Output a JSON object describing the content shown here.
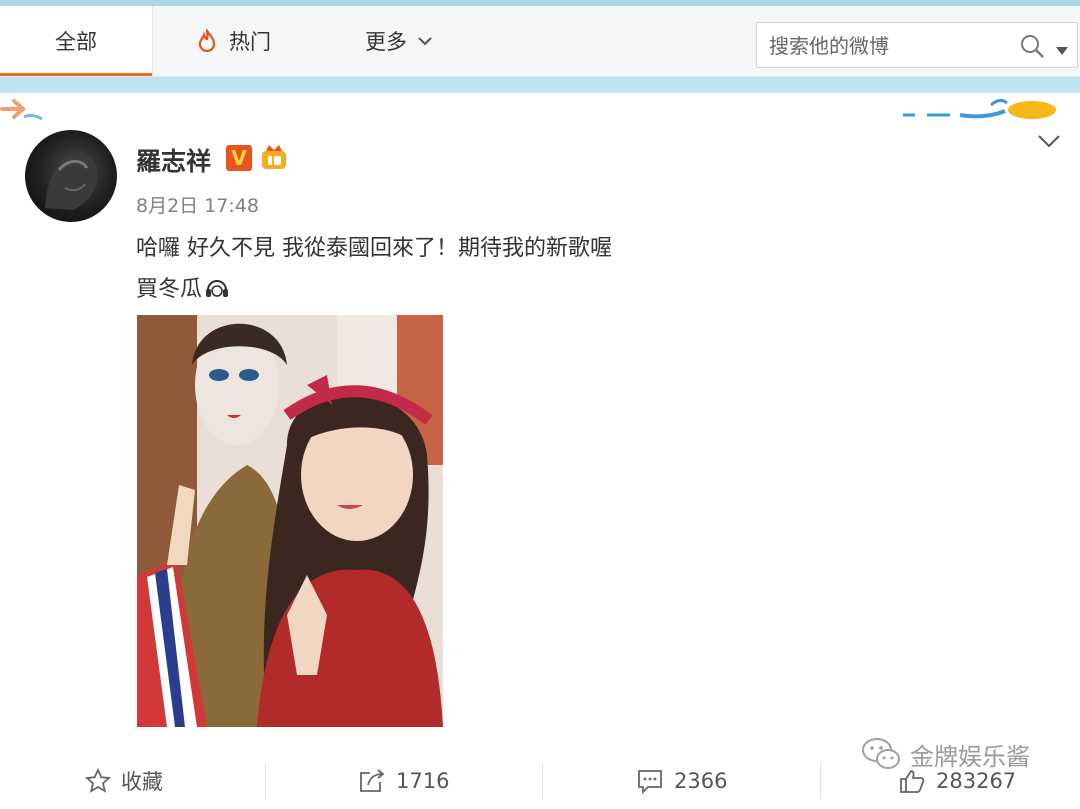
{
  "tabs": {
    "all_label": "全部",
    "hot_label": "热门",
    "more_label": "更多"
  },
  "search": {
    "placeholder": "搜索他的微博"
  },
  "post": {
    "author": "羅志祥",
    "timestamp": "8月2日 17:48",
    "text_line1": "哈囉 好久不見 我從泰國回來了！期待我的新歌喔",
    "text_line2": "買冬瓜"
  },
  "actions": {
    "favorite_label": "收藏",
    "repost_count": "1716",
    "comment_count": "2366",
    "like_count": "283267"
  },
  "watermark": "金牌娱乐酱",
  "icons": {
    "hot": "flame-icon",
    "more": "chevron-down-icon",
    "search": "search-icon",
    "verified": "verified-v-icon",
    "crown": "crown-badge-icon",
    "collapse": "chevron-down-icon",
    "favorite": "star-icon",
    "repost": "repost-icon",
    "comment": "comment-icon",
    "like": "thumbs-up-icon",
    "wechat": "wechat-icon"
  },
  "colors": {
    "accent": "#f06b22",
    "verified": "#e8541c",
    "link_blue": "#a9d6e8"
  }
}
